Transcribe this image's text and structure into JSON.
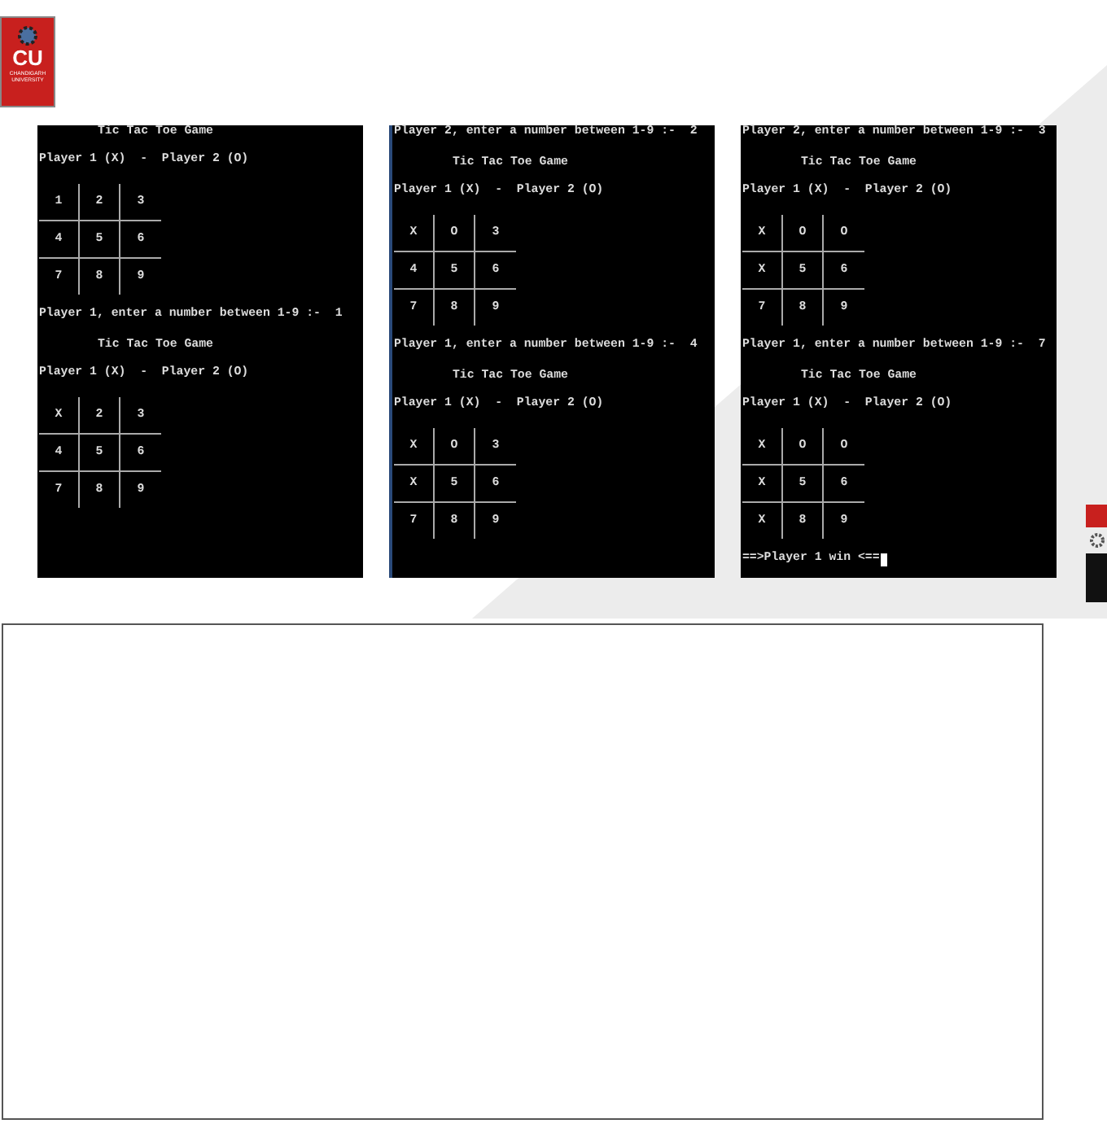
{
  "logo": {
    "mark": "CU",
    "line_1": "CHANDIGARH",
    "line_2": "UNIVERSITY"
  },
  "terminals": [
    {
      "lines": [
        {
          "kind": "title",
          "text": "Tic Tac Toe Game"
        },
        {
          "kind": "text",
          "text": "Player 1 (X)  -  Player 2 (O)"
        },
        {
          "kind": "board",
          "cells": [
            "1",
            "2",
            "3",
            "4",
            "5",
            "6",
            "7",
            "8",
            "9"
          ]
        },
        {
          "kind": "text",
          "text": "Player 1, enter a number between 1-9 :-  1"
        },
        {
          "kind": "title",
          "text": "Tic Tac Toe Game"
        },
        {
          "kind": "text",
          "text": "Player 1 (X)  -  Player 2 (O)"
        },
        {
          "kind": "board",
          "cells": [
            "X",
            "2",
            "3",
            "4",
            "5",
            "6",
            "7",
            "8",
            "9"
          ]
        }
      ]
    },
    {
      "lines": [
        {
          "kind": "text",
          "text": "Player 2, enter a number between 1-9 :-  2"
        },
        {
          "kind": "title",
          "text": "Tic Tac Toe Game"
        },
        {
          "kind": "text",
          "text": "Player 1 (X)  -  Player 2 (O)"
        },
        {
          "kind": "board",
          "cells": [
            "X",
            "O",
            "3",
            "4",
            "5",
            "6",
            "7",
            "8",
            "9"
          ]
        },
        {
          "kind": "text",
          "text": "Player 1, enter a number between 1-9 :-  4"
        },
        {
          "kind": "title",
          "text": "Tic Tac Toe Game"
        },
        {
          "kind": "text",
          "text": "Player 1 (X)  -  Player 2 (O)"
        },
        {
          "kind": "board",
          "cells": [
            "X",
            "O",
            "3",
            "X",
            "5",
            "6",
            "7",
            "8",
            "9"
          ]
        }
      ]
    },
    {
      "lines": [
        {
          "kind": "text",
          "text": "Player 2, enter a number between 1-9 :-  3"
        },
        {
          "kind": "title",
          "text": "Tic Tac Toe Game"
        },
        {
          "kind": "text",
          "text": "Player 1 (X)  -  Player 2 (O)"
        },
        {
          "kind": "board",
          "cells": [
            "X",
            "O",
            "O",
            "X",
            "5",
            "6",
            "7",
            "8",
            "9"
          ]
        },
        {
          "kind": "text",
          "text": "Player 1, enter a number between 1-9 :-  7"
        },
        {
          "kind": "title",
          "text": "Tic Tac Toe Game"
        },
        {
          "kind": "text",
          "text": "Player 1 (X)  -  Player 2 (O)"
        },
        {
          "kind": "board",
          "cells": [
            "X",
            "O",
            "O",
            "X",
            "5",
            "6",
            "X",
            "8",
            "9"
          ]
        },
        {
          "kind": "result",
          "text": "==>Player 1 win <=="
        }
      ]
    }
  ]
}
